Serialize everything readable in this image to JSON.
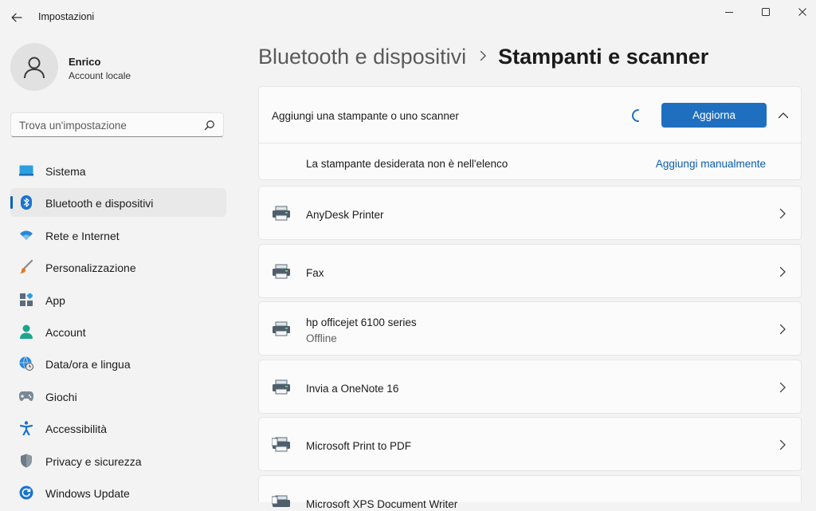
{
  "window": {
    "title": "Impostazioni",
    "controls": [
      "minimize",
      "maximize",
      "close"
    ]
  },
  "user": {
    "name": "Enrico",
    "account_type": "Account locale"
  },
  "search": {
    "placeholder": "Trova un'impostazione"
  },
  "sidebar": {
    "items": [
      {
        "label": "Sistema",
        "icon": "system-icon",
        "selected": false
      },
      {
        "label": "Bluetooth e dispositivi",
        "icon": "bluetooth-icon",
        "selected": true
      },
      {
        "label": "Rete e Internet",
        "icon": "wifi-icon",
        "selected": false
      },
      {
        "label": "Personalizzazione",
        "icon": "brush-icon",
        "selected": false
      },
      {
        "label": "App",
        "icon": "apps-icon",
        "selected": false
      },
      {
        "label": "Account",
        "icon": "account-icon",
        "selected": false
      },
      {
        "label": "Data/ora e lingua",
        "icon": "globe-clock-icon",
        "selected": false
      },
      {
        "label": "Giochi",
        "icon": "gamepad-icon",
        "selected": false
      },
      {
        "label": "Accessibilità",
        "icon": "accessibility-icon",
        "selected": false
      },
      {
        "label": "Privacy e sicurezza",
        "icon": "shield-icon",
        "selected": false
      },
      {
        "label": "Windows Update",
        "icon": "update-icon",
        "selected": false
      }
    ]
  },
  "breadcrumb": {
    "parent": "Bluetooth e dispositivi",
    "separator": ">",
    "current": "Stampanti e scanner"
  },
  "add_device": {
    "title": "Aggiungi una stampante o uno scanner",
    "refresh_label": "Aggiorna",
    "missing_text": "La stampante desiderata non è nell'elenco",
    "manual_link": "Aggiungi manualmente"
  },
  "printers": [
    {
      "name": "AnyDesk Printer",
      "status": ""
    },
    {
      "name": "Fax",
      "status": ""
    },
    {
      "name": "hp officejet 6100 series",
      "status": "Offline"
    },
    {
      "name": "Invia a OneNote 16",
      "status": ""
    },
    {
      "name": "Microsoft Print to PDF",
      "status": ""
    },
    {
      "name": "Microsoft XPS Document Writer",
      "status": ""
    }
  ],
  "colors": {
    "accent": "#1f6fc0",
    "link": "#0b5cad",
    "selection_bar": "#005fb8",
    "background": "#f3f3f3"
  }
}
